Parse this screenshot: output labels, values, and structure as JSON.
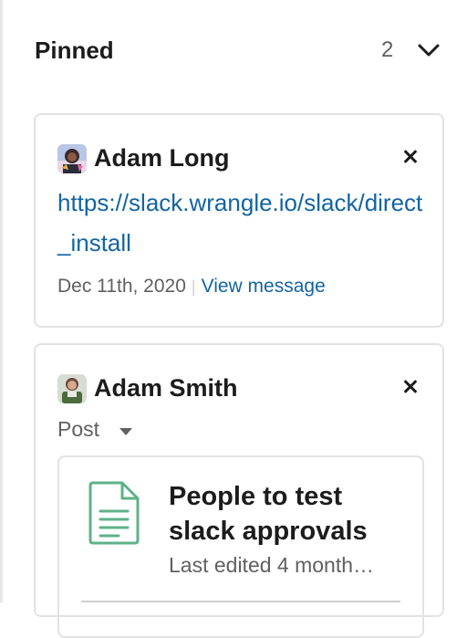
{
  "pinned": {
    "title": "Pinned",
    "count": "2",
    "items": [
      {
        "author": "Adam Long",
        "link_text": "https://slack.wrangle.io/slack/direct_install",
        "date": "Dec 11th, 2020",
        "separator": "|",
        "view_label": "View message"
      },
      {
        "author": "Adam Smith",
        "type_label": "Post",
        "post_title": "People to test slack approvals",
        "post_subtitle": "Last edited 4 month…"
      }
    ]
  },
  "icons": {
    "chevron": "chevron-down-icon",
    "close": "close-icon",
    "caret": "caret-down-icon",
    "document": "document-icon"
  },
  "colors": {
    "link": "#1264a3",
    "text": "#1d1c1d",
    "muted": "#616061",
    "border": "#e2e2e2",
    "doc_icon": "#5fb18a"
  }
}
